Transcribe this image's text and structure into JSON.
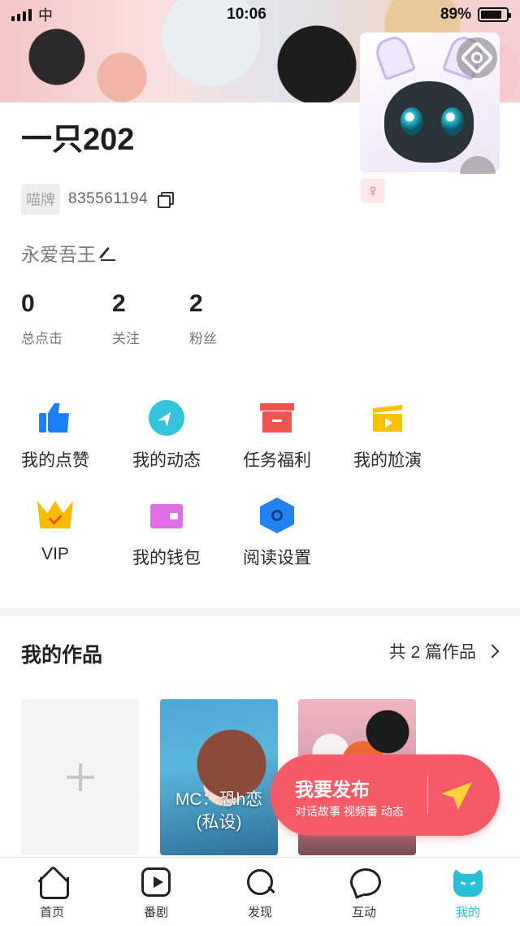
{
  "status_bar": {
    "carrier": "中",
    "time": "10:06",
    "battery": "89%"
  },
  "profile": {
    "username": "一只202",
    "badge": "喵牌",
    "uid": "835561194",
    "gender_symbol": "♀",
    "bio": "永爱吾王"
  },
  "stats": [
    {
      "value": "0",
      "label": "总点击"
    },
    {
      "value": "2",
      "label": "关注"
    },
    {
      "value": "2",
      "label": "粉丝"
    }
  ],
  "menu": [
    {
      "label": "我的点赞",
      "icon": "thumbs-up-icon",
      "color": "#1b7ff5"
    },
    {
      "label": "我的动态",
      "icon": "compass-icon",
      "color": "#33c4dc"
    },
    {
      "label": "任务福利",
      "icon": "gift-box-icon",
      "color": "#f0544f"
    },
    {
      "label": "我的尬演",
      "icon": "clapperboard-icon",
      "color": "#f9c100"
    },
    {
      "label": "VIP",
      "icon": "crown-icon",
      "color": "#f9bd00"
    },
    {
      "label": "我的钱包",
      "icon": "wallet-icon",
      "color": "#e06fe6"
    },
    {
      "label": "阅读设置",
      "icon": "hexagon-settings-icon",
      "color": "#2382f0"
    }
  ],
  "works": {
    "title": "我的作品",
    "count_label": "共 2 篇作品",
    "items": [
      {
        "title": "MC：恐h恋\n(私设)"
      },
      {
        "title": ""
      }
    ]
  },
  "publish": {
    "title": "我要发布",
    "subtitle": "对话故事 视频番 动态",
    "color": "#f45b67"
  },
  "tabbar": [
    {
      "label": "首页",
      "icon": "home-icon",
      "active": false
    },
    {
      "label": "番剧",
      "icon": "play-icon",
      "active": false
    },
    {
      "label": "发现",
      "icon": "search-icon",
      "active": false
    },
    {
      "label": "互动",
      "icon": "chat-bubble-icon",
      "active": false
    },
    {
      "label": "我的",
      "icon": "cat-face-icon",
      "active": true
    }
  ],
  "accent_color": "#29bfd9"
}
